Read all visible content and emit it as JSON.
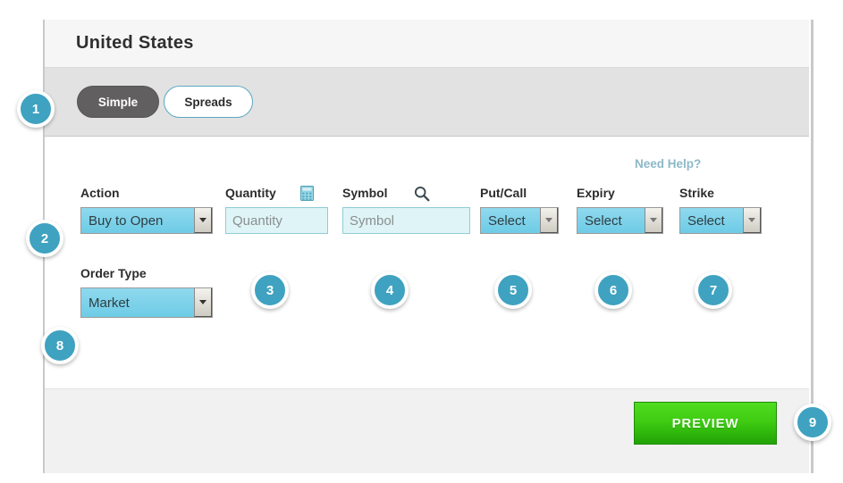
{
  "header": {
    "title": "United States"
  },
  "tabs": [
    {
      "label": "Simple",
      "selected": true
    },
    {
      "label": "Spreads",
      "selected": false
    }
  ],
  "form": {
    "need_help_label": "Need Help?",
    "fields": [
      {
        "label": "Action",
        "type": "select",
        "value": "Buy to Open",
        "icon": null
      },
      {
        "label": "Quantity",
        "type": "text",
        "value": "",
        "placeholder": "Quantity",
        "icon": "calculator-icon"
      },
      {
        "label": "Symbol",
        "type": "text",
        "value": "",
        "placeholder": "Symbol",
        "icon": "search-icon"
      },
      {
        "label": "Put/Call",
        "type": "select",
        "value": "Select",
        "icon": null
      },
      {
        "label": "Expiry",
        "type": "select",
        "value": "Select",
        "icon": null
      },
      {
        "label": "Strike",
        "type": "select",
        "value": "Select",
        "icon": null
      },
      {
        "label": "Order Type",
        "type": "select",
        "value": "Market",
        "icon": null
      }
    ]
  },
  "footer": {
    "preview_label": "PREVIEW"
  },
  "callouts": [
    {
      "number": "1"
    },
    {
      "number": "2"
    },
    {
      "number": "3"
    },
    {
      "number": "4"
    },
    {
      "number": "5"
    },
    {
      "number": "6"
    },
    {
      "number": "7"
    },
    {
      "number": "8"
    },
    {
      "number": "9"
    }
  ],
  "colors": {
    "badge": "#3fa2c0",
    "tab_active": "#615f5f",
    "tab_border": "#59a8c0",
    "select_fill": "#6ecbe6",
    "input_fill": "#dff4f6",
    "preview_green": "#3fcc12",
    "need_help": "#8cb9c9"
  }
}
